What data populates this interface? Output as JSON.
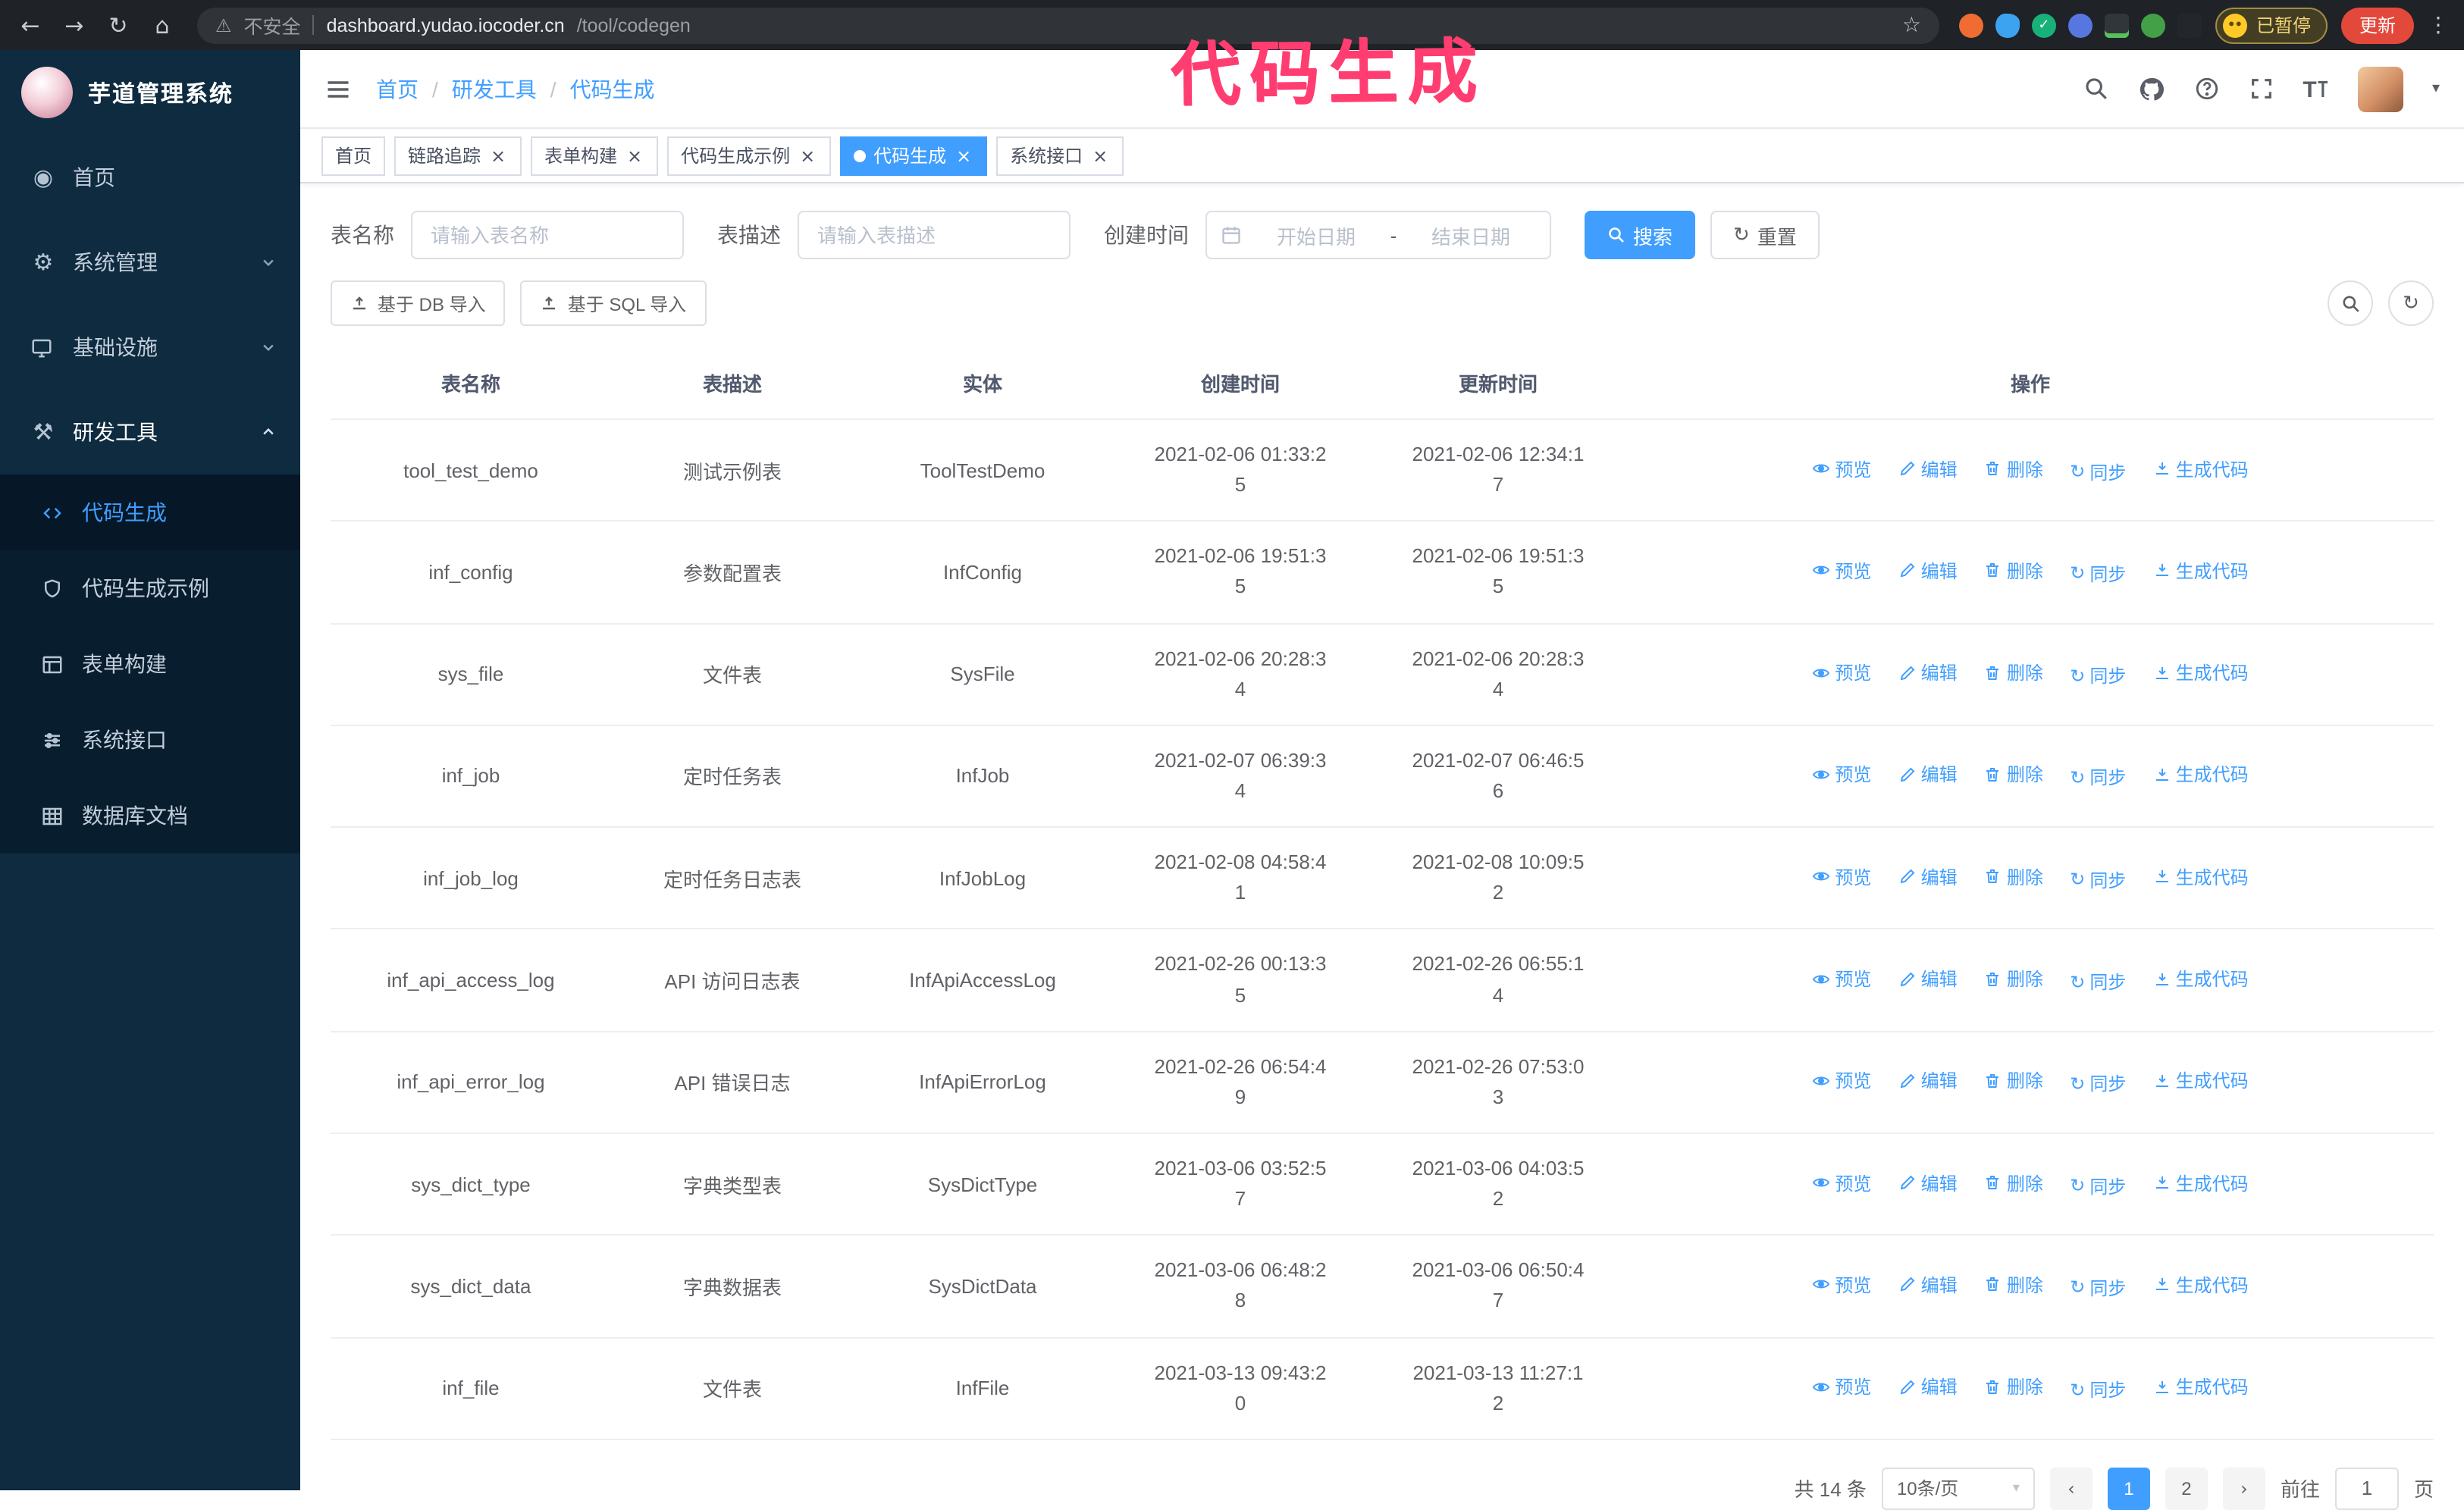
{
  "annotation": {
    "text": "代码生成"
  },
  "browser": {
    "security_label": "不安全",
    "url_host": "dashboard.yudao.iocoder.cn",
    "url_path": "/tool/codegen",
    "profile_badge": "已暂停",
    "update_button": "更新"
  },
  "sidebar": {
    "logo_title": "芋道管理系统",
    "items": [
      {
        "label": "首页"
      },
      {
        "label": "系统管理"
      },
      {
        "label": "基础设施"
      },
      {
        "label": "研发工具"
      }
    ],
    "subitems": [
      {
        "label": "代码生成"
      },
      {
        "label": "代码生成示例"
      },
      {
        "label": "表单构建"
      },
      {
        "label": "系统接口"
      },
      {
        "label": "数据库文档"
      }
    ]
  },
  "header": {
    "breadcrumb": [
      "首页",
      "研发工具",
      "代码生成"
    ],
    "separator": "/"
  },
  "tabs": [
    {
      "label": "首页"
    },
    {
      "label": "链路追踪"
    },
    {
      "label": "表单构建"
    },
    {
      "label": "代码生成示例"
    },
    {
      "label": "代码生成"
    },
    {
      "label": "系统接口"
    }
  ],
  "filters": {
    "table_name_label": "表名称",
    "table_name_placeholder": "请输入表名称",
    "table_desc_label": "表描述",
    "table_desc_placeholder": "请输入表描述",
    "create_time_label": "创建时间",
    "start_date_placeholder": "开始日期",
    "date_separator": "-",
    "end_date_placeholder": "结束日期",
    "search_button": "搜索",
    "reset_button": "重置"
  },
  "toolbar": {
    "import_db_button": "基于 DB 导入",
    "import_sql_button": "基于 SQL 导入"
  },
  "table": {
    "columns": [
      "表名称",
      "表描述",
      "实体",
      "创建时间",
      "更新时间",
      "操作"
    ],
    "action_labels": [
      "预览",
      "编辑",
      "删除",
      "同步",
      "生成代码"
    ],
    "rows": [
      {
        "name": "tool_test_demo",
        "desc": "测试示例表",
        "entity": "ToolTestDemo",
        "created": "2021-02-06 01:33:25",
        "updated": "2021-02-06 12:34:17"
      },
      {
        "name": "inf_config",
        "desc": "参数配置表",
        "entity": "InfConfig",
        "created": "2021-02-06 19:51:35",
        "updated": "2021-02-06 19:51:35"
      },
      {
        "name": "sys_file",
        "desc": "文件表",
        "entity": "SysFile",
        "created": "2021-02-06 20:28:34",
        "updated": "2021-02-06 20:28:34"
      },
      {
        "name": "inf_job",
        "desc": "定时任务表",
        "entity": "InfJob",
        "created": "2021-02-07 06:39:34",
        "updated": "2021-02-07 06:46:56"
      },
      {
        "name": "inf_job_log",
        "desc": "定时任务日志表",
        "entity": "InfJobLog",
        "created": "2021-02-08 04:58:41",
        "updated": "2021-02-08 10:09:52"
      },
      {
        "name": "inf_api_access_log",
        "desc": "API 访问日志表",
        "entity": "InfApiAccessLog",
        "created": "2021-02-26 00:13:35",
        "updated": "2021-02-26 06:55:14"
      },
      {
        "name": "inf_api_error_log",
        "desc": "API 错误日志",
        "entity": "InfApiErrorLog",
        "created": "2021-02-26 06:54:49",
        "updated": "2021-02-26 07:53:03"
      },
      {
        "name": "sys_dict_type",
        "desc": "字典类型表",
        "entity": "SysDictType",
        "created": "2021-03-06 03:52:57",
        "updated": "2021-03-06 04:03:52"
      },
      {
        "name": "sys_dict_data",
        "desc": "字典数据表",
        "entity": "SysDictData",
        "created": "2021-03-06 06:48:28",
        "updated": "2021-03-06 06:50:47"
      },
      {
        "name": "inf_file",
        "desc": "文件表",
        "entity": "InfFile",
        "created": "2021-03-13 09:43:20",
        "updated": "2021-03-13 11:27:12"
      }
    ]
  },
  "pagination": {
    "total_label": "共 14 条",
    "page_size": "10条/页",
    "pages": [
      "1",
      "2"
    ],
    "goto_label": "前往",
    "goto_value": "1",
    "page_unit": "页"
  },
  "colors": {
    "accent": "#409eff",
    "sidebar_bg": "#0e2b40",
    "submenu_bg": "#081e2f",
    "annotation": "#ff3d71",
    "update_button_bg": "#e2493b"
  }
}
